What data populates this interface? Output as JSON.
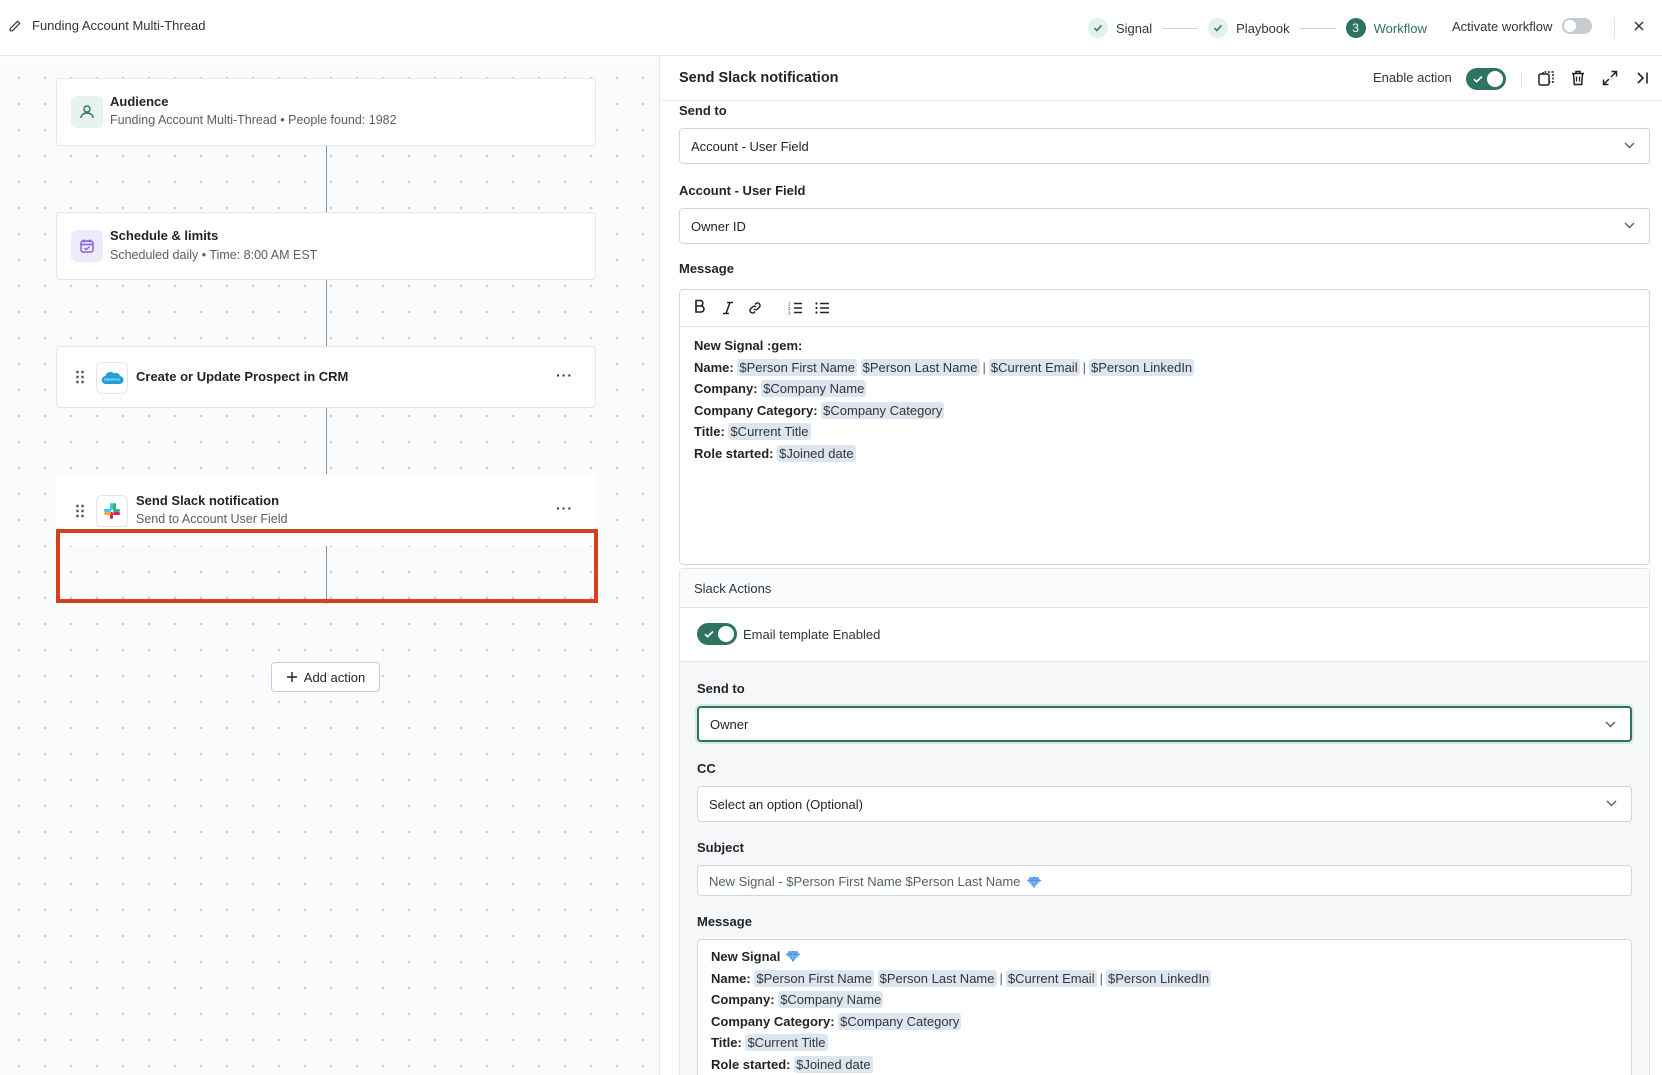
{
  "topbar": {
    "title": "Funding Account Multi-Thread",
    "steps": [
      {
        "label": "Signal",
        "state": "done"
      },
      {
        "label": "Playbook",
        "state": "done"
      },
      {
        "label": "Workflow",
        "number": "3",
        "state": "active"
      }
    ],
    "activate_label": "Activate workflow",
    "activate_enabled": false
  },
  "canvas": {
    "nodes": [
      {
        "title": "Audience",
        "subtitle_a": "Funding Account Multi-Thread",
        "subtitle_b": "People found: 1982",
        "icon": "users-icon"
      },
      {
        "title": "Schedule & limits",
        "subtitle_a": "Scheduled daily",
        "subtitle_b": "Time: 8:00 AM EST",
        "icon": "calendar-check-icon"
      },
      {
        "title": "Create or Update Prospect in CRM",
        "icon": "salesforce-icon"
      },
      {
        "title": "Send Slack notification",
        "subtitle": "Send to Account User Field",
        "icon": "slack-icon",
        "selected": true
      }
    ],
    "bullet": "•",
    "menu_glyph": "···",
    "add_action_label": "Add action"
  },
  "panel": {
    "title": "Send Slack notification",
    "enable_action_label": "Enable action",
    "enable_action": true,
    "send_to_label": "Send to",
    "send_to_value": "Account - User Field",
    "account_field_label": "Account - User Field",
    "account_field_value": "Owner ID",
    "message_label": "Message",
    "message": {
      "line1": "New Signal :gem:",
      "name_key": "Name:",
      "first_name": "$Person First Name",
      "last_name": "$Person Last Name",
      "email": "$Current Email",
      "linkedin": "$Person LinkedIn",
      "separator": "|",
      "company_key": "Company:",
      "company": "$Company Name",
      "category_key": "Company Category:",
      "category": "$Company Category",
      "title_key": "Title:",
      "title": "$Current Title",
      "role_key": "Role started:",
      "role": "$Joined date"
    },
    "slack_actions": {
      "header": "Slack Actions",
      "email_template_label": "Email template Enabled",
      "email_template_enabled": true,
      "send_to_label": "Send to",
      "send_to_value": "Owner",
      "cc_label": "CC",
      "cc_placeholder": "Select an option (Optional)",
      "subject_label": "Subject",
      "subject_value": "New Signal - $Person First Name $Person Last Name",
      "message_label": "Message",
      "message_line1": "New Signal"
    }
  }
}
